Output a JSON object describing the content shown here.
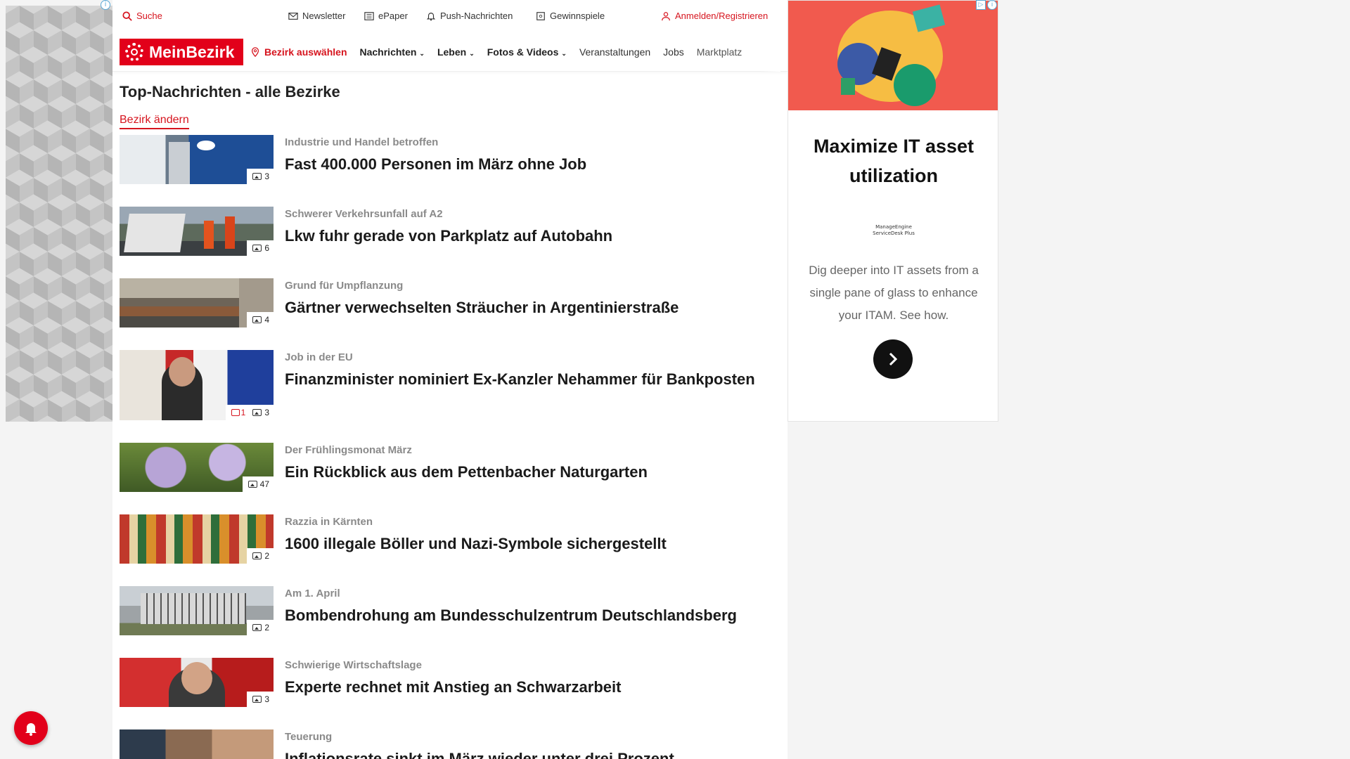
{
  "topbar": {
    "search_label": "Suche",
    "newsletter_label": "Newsletter",
    "epaper_label": "ePaper",
    "push_label": "Push-Nachrichten",
    "games_label": "Gewinnspiele",
    "login_label": "Anmelden/Registrieren"
  },
  "nav": {
    "logo_text": "MeinBezirk",
    "bezirk_select": "Bezirk auswählen",
    "items": [
      "Nachrichten",
      "Leben",
      "Fotos & Videos",
      "Veranstaltungen",
      "Jobs",
      "Marktplatz"
    ]
  },
  "section": {
    "title": "Top-Nachrichten - alle Bezirke",
    "change_bezirk": "Bezirk ändern"
  },
  "articles": [
    {
      "kicker": "Industrie und Handel betroffen",
      "headline": "Fast 400.000 Personen im März ohne Job",
      "photos": "3",
      "comments": ""
    },
    {
      "kicker": "Schwerer Verkehrsunfall auf A2",
      "headline": "Lkw fuhr gerade von Parkplatz auf Autobahn",
      "photos": "6",
      "comments": ""
    },
    {
      "kicker": "Grund für Umpflanzung",
      "headline": "Gärtner verwechselten Sträucher in Argentinierstraße",
      "photos": "4",
      "comments": ""
    },
    {
      "kicker": "Job in der EU",
      "headline": "Finanzminister nominiert Ex-Kanzler Nehammer für Bankposten",
      "photos": "3",
      "comments": "1"
    },
    {
      "kicker": "Der Frühlingsmonat März",
      "headline": "Ein Rückblick aus dem Pettenbacher Naturgarten",
      "photos": "47",
      "comments": ""
    },
    {
      "kicker": "Razzia in Kärnten",
      "headline": "1600 illegale Böller und Nazi-Symbole sichergestellt",
      "photos": "2",
      "comments": ""
    },
    {
      "kicker": "Am 1. April",
      "headline": "Bombendrohung am Bundesschulzentrum Deutschlandsberg",
      "photos": "2",
      "comments": ""
    },
    {
      "kicker": "Schwierige Wirtschaftslage",
      "headline": "Experte rechnet mit Anstieg an Schwarzarbeit",
      "photos": "3",
      "comments": ""
    },
    {
      "kicker": "Teuerung",
      "headline": "Inflationsrate sinkt im März wieder unter drei Prozent",
      "photos": "",
      "comments": ""
    }
  ],
  "ad": {
    "title": "Maximize IT asset utilization",
    "brand_line1": "ManageEngine",
    "brand_line2": "ServiceDesk Plus",
    "description": "Dig deeper into IT assets from a single pane of glass to enhance your ITAM. See how."
  },
  "colors": {
    "brand_red": "#e2001a",
    "ad_banner": "#f15a4e"
  }
}
